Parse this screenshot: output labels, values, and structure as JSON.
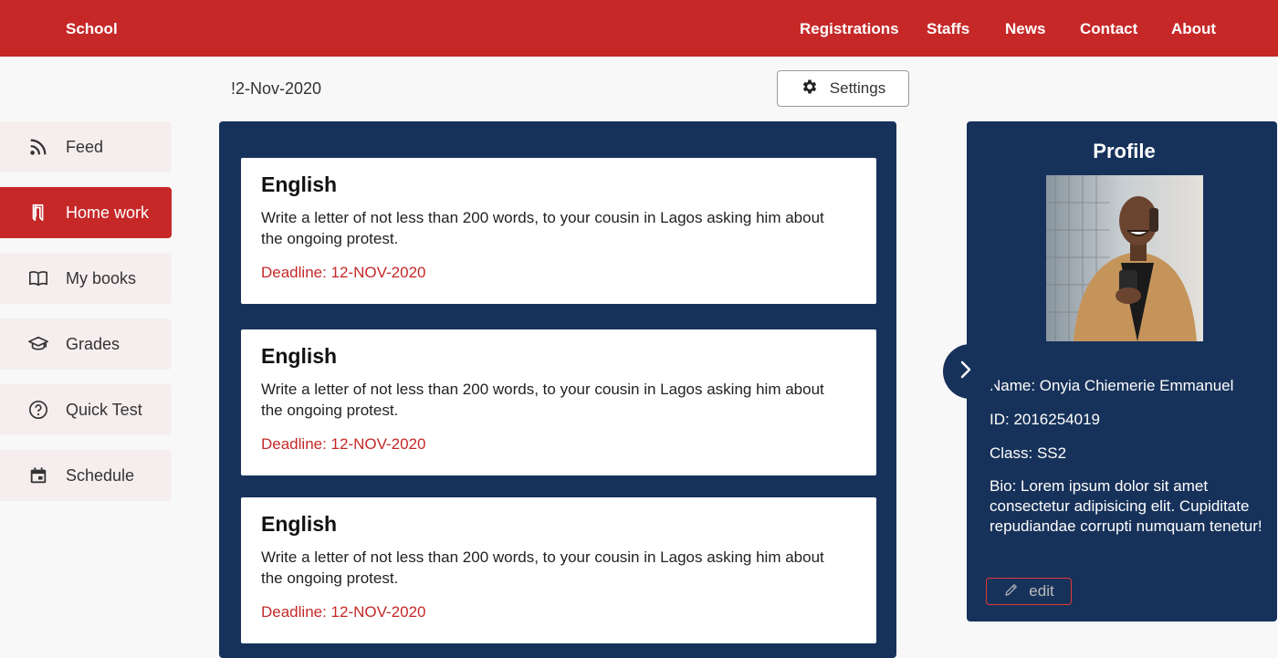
{
  "header": {
    "brand": "School",
    "nav": [
      "Registrations",
      "Staffs",
      "News",
      "Contact",
      "About"
    ]
  },
  "toolbar": {
    "date": "!2-Nov-2020",
    "settings_label": "Settings"
  },
  "sidebar": {
    "items": [
      {
        "label": "Feed",
        "icon": "rss-icon",
        "active": false
      },
      {
        "label": "Home work",
        "icon": "bookmark-book-icon",
        "active": true
      },
      {
        "label": "My books",
        "icon": "open-book-icon",
        "active": false
      },
      {
        "label": "Grades",
        "icon": "graduation-cap-icon",
        "active": false
      },
      {
        "label": "Quick Test",
        "icon": "question-circle-icon",
        "active": false
      },
      {
        "label": "Schedule",
        "icon": "calendar-icon",
        "active": false
      }
    ]
  },
  "homework": [
    {
      "subject": "English",
      "text": "Write a letter of not less than 200 words, to your cousin in Lagos asking him about the ongoing protest.",
      "deadline": "Deadline: 12-NOV-2020"
    },
    {
      "subject": "English",
      "text": "Write a letter of not less than 200 words, to your cousin in Lagos asking him about the ongoing protest.",
      "deadline": "Deadline: 12-NOV-2020"
    },
    {
      "subject": "English",
      "text": "Write a letter of not less than 200 words, to your cousin in Lagos asking him about the ongoing protest.",
      "deadline": "Deadline: 12-NOV-2020"
    }
  ],
  "profile": {
    "title": "Profile",
    "name": "Name:  Onyia Chiemerie Emmanuel",
    "id": "ID:  2016254019",
    "class": "Class:  SS2",
    "bio": "Bio: Lorem ipsum dolor sit amet consectetur adipisicing elit. Cupiditate repudiandae corrupti numquam tenetur!",
    "edit_label": "edit"
  },
  "colors": {
    "brand_red": "#c62828",
    "panel_navy": "#17325a",
    "sidebar_bg": "#f6eeee"
  }
}
